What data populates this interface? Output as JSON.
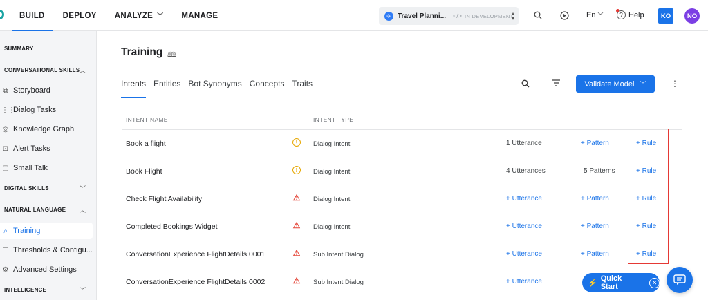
{
  "nav": {
    "items": [
      {
        "label": "BUILD"
      },
      {
        "label": "DEPLOY"
      },
      {
        "label": "ANALYZE"
      },
      {
        "label": "MANAGE"
      }
    ]
  },
  "bot": {
    "name": "Travel Planni...",
    "status": "IN DEVELOPMENT"
  },
  "header": {
    "language": "En",
    "help": "Help",
    "user1": "KO",
    "user2": "NO"
  },
  "sidebar": {
    "summary": "SUMMARY",
    "conversational": "CONVERSATIONAL SKILLS",
    "items_conv": [
      {
        "label": "Storyboard"
      },
      {
        "label": "Dialog Tasks"
      },
      {
        "label": "Knowledge Graph"
      },
      {
        "label": "Alert Tasks"
      },
      {
        "label": "Small Talk"
      }
    ],
    "digital": "DIGITAL SKILLS",
    "natural": "NATURAL LANGUAGE",
    "items_nl": [
      {
        "label": "Training"
      },
      {
        "label": "Thresholds & Configu..."
      },
      {
        "label": "Advanced Settings"
      }
    ],
    "intelligence": "INTELLIGENCE"
  },
  "main": {
    "title": "Training",
    "tabs": [
      {
        "label": "Intents"
      },
      {
        "label": "Entities"
      },
      {
        "label": "Bot Synonyms"
      },
      {
        "label": "Concepts"
      },
      {
        "label": "Traits"
      }
    ],
    "validate_label": "Validate Model",
    "columns": {
      "name": "INTENT NAME",
      "type": "INTENT TYPE"
    },
    "rows": [
      {
        "name": "Book a flight",
        "status": "warn",
        "type": "Dialog Intent",
        "utterance": "1 Utterance",
        "pattern": "+ Pattern",
        "rule": "+ Rule"
      },
      {
        "name": "Book Flight",
        "status": "warn",
        "type": "Dialog Intent",
        "utterance": "4 Utterances",
        "pattern": "5 Patterns",
        "rule": "+ Rule"
      },
      {
        "name": "Check Flight Availability",
        "status": "error",
        "type": "Dialog Intent",
        "utterance": "+ Utterance",
        "pattern": "+ Pattern",
        "rule": "+ Rule"
      },
      {
        "name": "Completed Bookings Widget",
        "status": "error",
        "type": "Dialog Intent",
        "utterance": "+ Utterance",
        "pattern": "+ Pattern",
        "rule": "+ Rule"
      },
      {
        "name": "ConversationExperience FlightDetails 0001",
        "status": "error",
        "type": "Sub Intent Dialog",
        "utterance": "+ Utterance",
        "pattern": "+ Pattern",
        "rule": "+ Rule"
      },
      {
        "name": "ConversationExperience FlightDetails 0002",
        "status": "error",
        "type": "Sub Intent Dialog",
        "utterance": "+ Utterance",
        "pattern": "",
        "rule": ""
      }
    ]
  },
  "quick_start": "Quick Start",
  "colors": {
    "accent": "#1a73e8",
    "highlight": "#e53935",
    "warn": "#e6a700",
    "error": "#e5483b"
  }
}
